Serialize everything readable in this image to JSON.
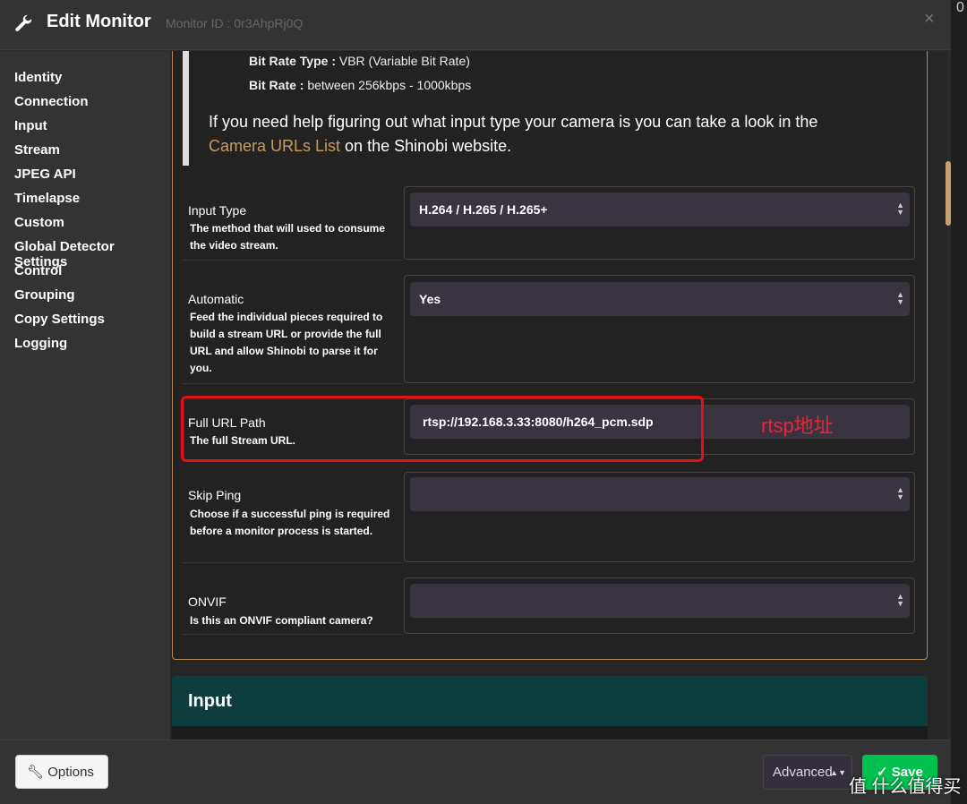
{
  "header": {
    "title": "Edit Monitor",
    "monitor_id": "Monitor ID : 0r3AhpRj0Q",
    "close": "×"
  },
  "edge_text": "0",
  "sidebar": {
    "items": [
      {
        "label": "Identity"
      },
      {
        "label": "Connection"
      },
      {
        "label": "Input"
      },
      {
        "label": "Stream"
      },
      {
        "label": "JPEG API"
      },
      {
        "label": "Timelapse"
      },
      {
        "label": "Custom"
      },
      {
        "label": "Global Detector Settings"
      },
      {
        "label": "Control"
      },
      {
        "label": "Grouping"
      },
      {
        "label": "Copy Settings"
      },
      {
        "label": "Logging"
      }
    ]
  },
  "info": {
    "bit_rate_type_label": "Bit Rate Type :",
    "bit_rate_type_value": " VBR (Variable Bit Rate)",
    "bit_rate_label": "Bit Rate :",
    "bit_rate_value": " between 256kbps - 1000kbps",
    "help_prefix": "If you need help figuring out what input type your camera is you can take a look in the",
    "help_link": "Camera URLs List",
    "help_suffix": " on the Shinobi website."
  },
  "fields": [
    {
      "label": "Input Type",
      "desc": "The method that will used to consume the video stream.",
      "value": "H.264 / H.265 / H.265+"
    },
    {
      "label": "Automatic",
      "desc": "Feed the individual pieces required to build a stream URL or provide the full URL and allow Shinobi to parse it for you.",
      "value": "Yes"
    },
    {
      "label": "Full URL Path",
      "desc": "The full Stream URL.",
      "value": "rtsp://192.168.3.33:8080/h264_pcm.sdp"
    },
    {
      "label": "Skip Ping",
      "desc": "Choose if a successful ping is required before a monitor process is started.",
      "value": ""
    },
    {
      "label": "ONVIF",
      "desc": "Is this an ONVIF compliant camera?",
      "value": ""
    }
  ],
  "annotation": "rtsp地址",
  "section": {
    "input_title": "Input"
  },
  "footer": {
    "options": "Options",
    "advanced": "Advanced",
    "save": "Save"
  },
  "watermark": "值 什么值得买",
  "colors": {
    "accent": "#c99a5a",
    "save": "#00c050",
    "highlight": "#e51010",
    "section": "#0d3d3d"
  }
}
